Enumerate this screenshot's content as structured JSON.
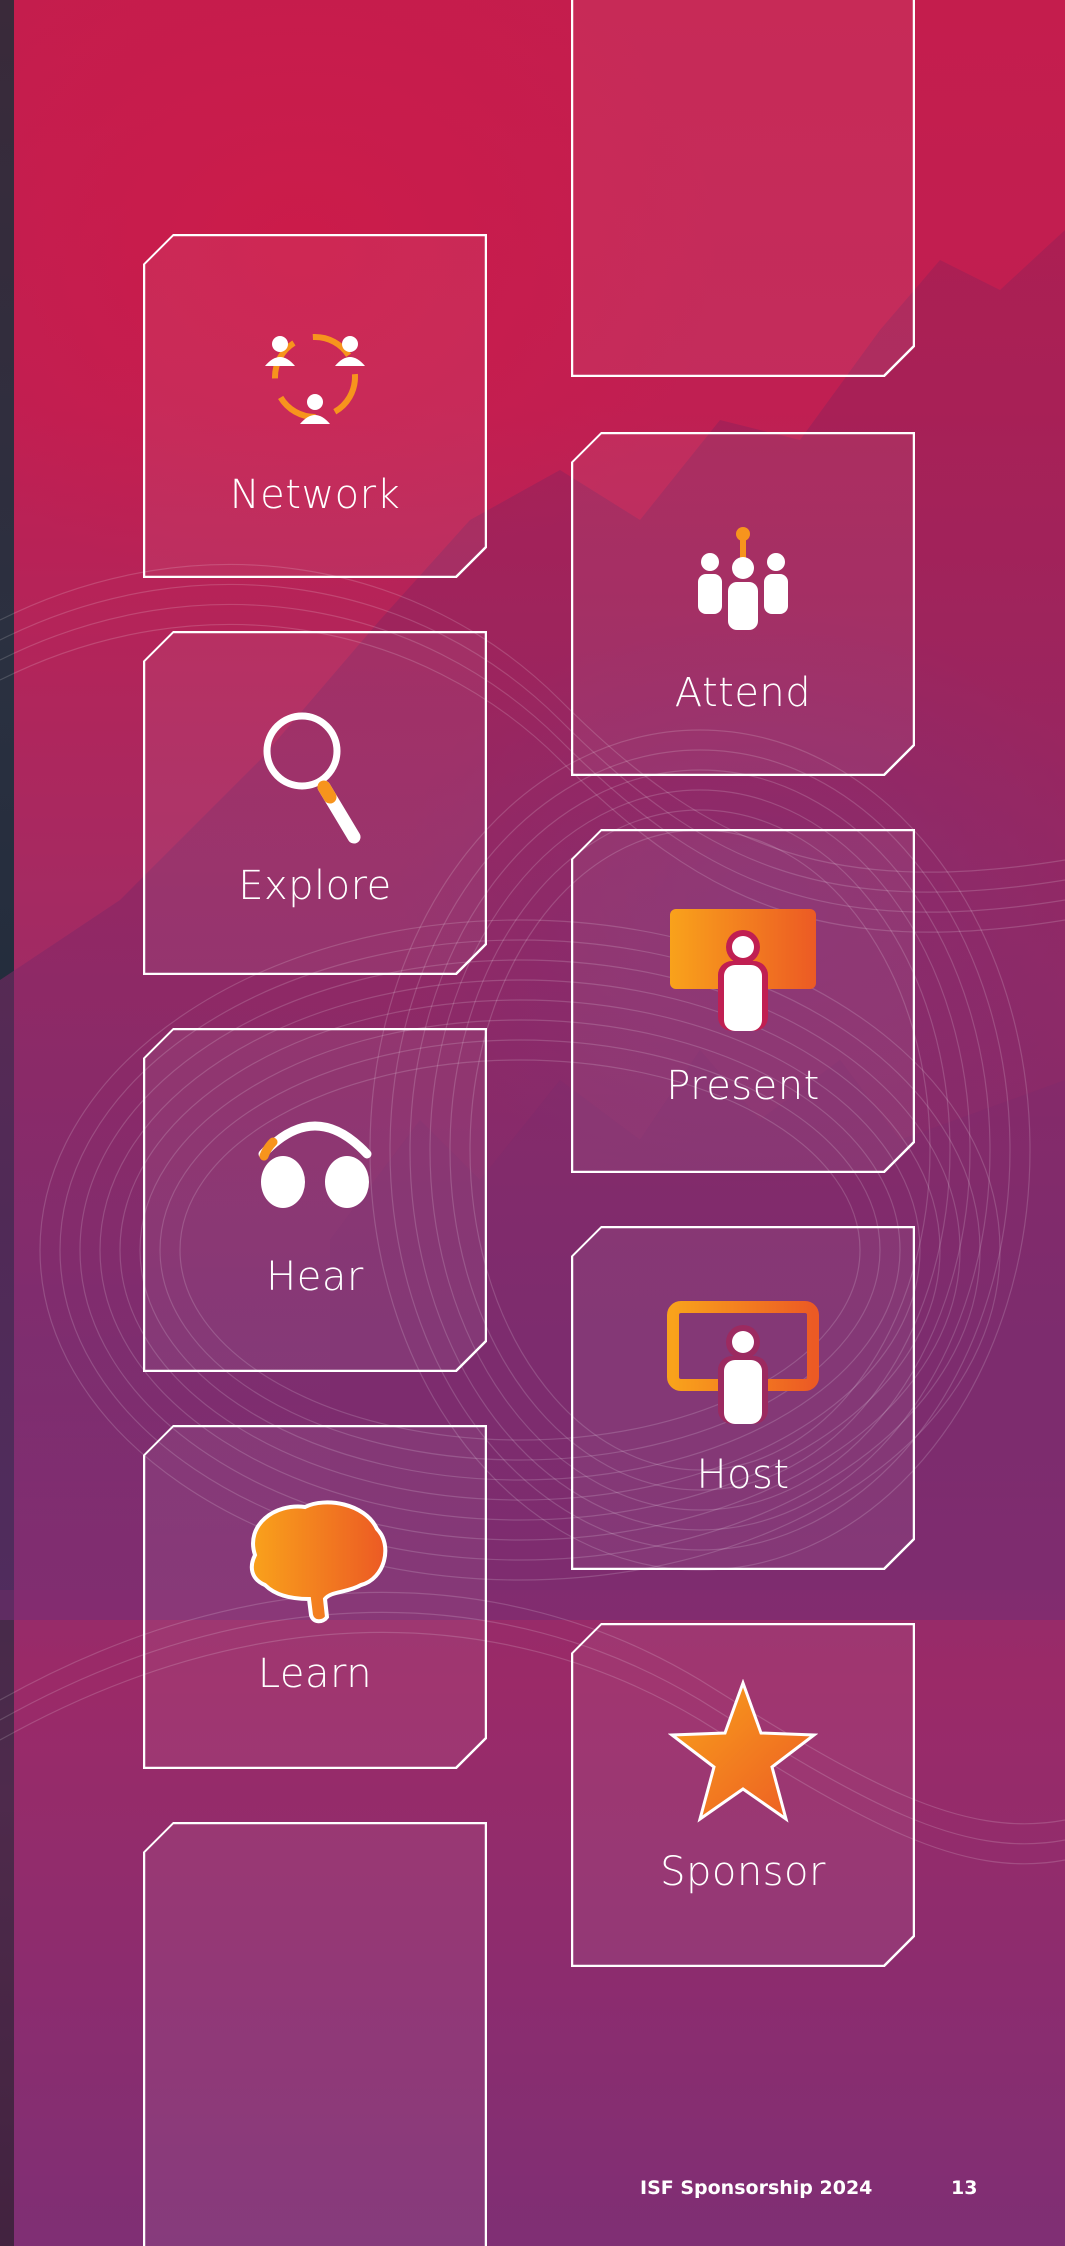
{
  "tiles": {
    "network": "Network",
    "attend": "Attend",
    "explore": "Explore",
    "present": "Present",
    "hear": "Hear",
    "host": "Host",
    "learn": "Learn",
    "sponsor": "Sponsor"
  },
  "icons": {
    "network": "network-icon",
    "attend": "audience-icon",
    "explore": "magnifier-icon",
    "present": "presenter-icon",
    "hear": "headphones-icon",
    "host": "host-screen-icon",
    "learn": "brain-icon",
    "sponsor": "star-icon"
  },
  "footer": {
    "title": "ISF Sponsorship 2024",
    "page_number": "13"
  },
  "colors": {
    "accent_orange": "#f7941d",
    "accent_red": "#e94e1b",
    "background_crimson": "#c41d4d",
    "background_purple": "#7b3076",
    "text": "#ffffff"
  }
}
